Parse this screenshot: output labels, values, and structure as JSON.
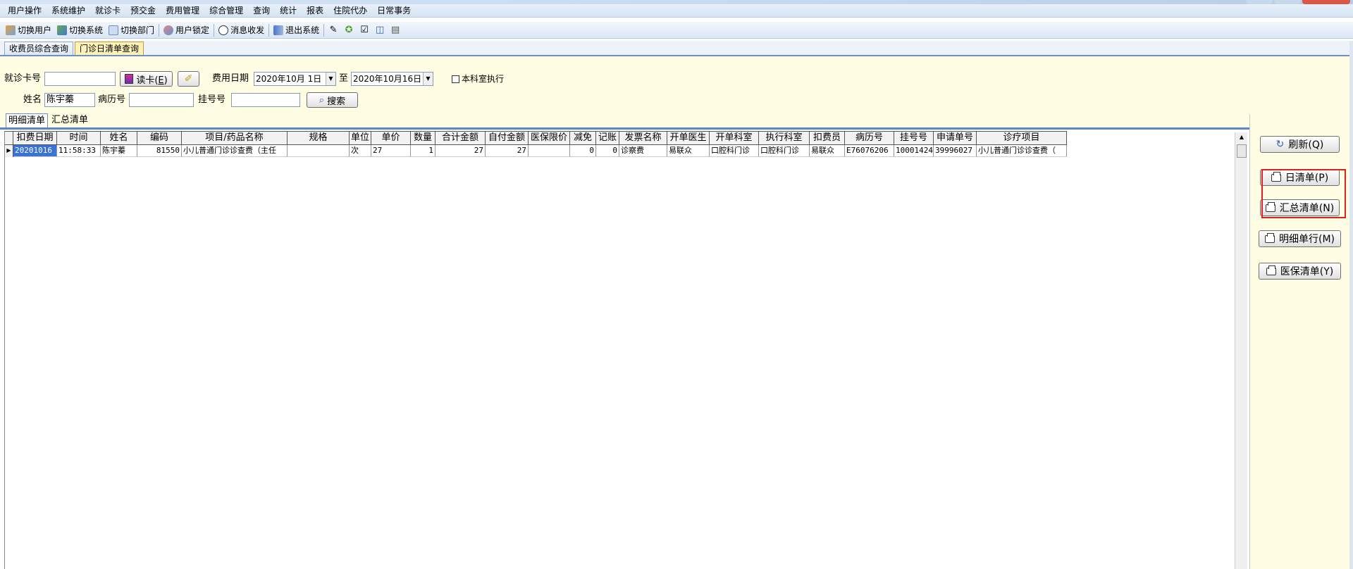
{
  "menu": [
    "用户操作",
    "系统维护",
    "就诊卡",
    "预交金",
    "费用管理",
    "综合管理",
    "查询",
    "统计",
    "报表",
    "住院代办",
    "日常事务"
  ],
  "toolbar": {
    "switch_user": "切换用户",
    "switch_system": "切换系统",
    "switch_dept": "切换部门",
    "lock_user": "用户锁定",
    "messages": "消息收发",
    "exit_system": "退出系统"
  },
  "page_tabs": [
    "收费员综合查询",
    "门诊日清单查询"
  ],
  "query": {
    "card_label": "就诊卡号",
    "card_value": "",
    "read_card_button": "读卡(<u>E</u>)",
    "fee_date_label": "费用日期",
    "date_from": "2020年10月 1日",
    "to_label": "至",
    "date_to": "2020年10月16日",
    "dept_exec_label": "本科室执行",
    "name_label": "姓名",
    "name_value": "陈宇蓁",
    "record_no_label": "病历号",
    "record_no_value": "",
    "reg_no_label": "挂号号",
    "reg_no_value": "",
    "search_button": "搜索"
  },
  "inner_tabs": [
    "明细清单",
    "汇总清单"
  ],
  "grid": {
    "columns": [
      "扣费日期",
      "时间",
      "姓名",
      "编码",
      "项目/药品名称",
      "规格",
      "单位",
      "单价",
      "数量",
      "合计金额",
      "自付金额",
      "医保限价",
      "减免",
      "记账",
      "发票名称",
      "开单医生",
      "开单科室",
      "执行科室",
      "扣费员",
      "病历号",
      "挂号号",
      "申请单号",
      "诊疗项目"
    ],
    "rows": [
      [
        "20201016",
        "11:58:33",
        "陈宇蓁",
        "81550",
        "小儿普通门诊诊查费（主任",
        "",
        "次",
        "27",
        "1",
        "27",
        "27",
        "",
        "0",
        "0",
        "诊察费",
        "易联众",
        "口腔科门诊",
        "口腔科门诊",
        "易联众",
        "E76076206",
        "10001424",
        "39996027",
        "小儿普通门诊诊查费（"
      ]
    ]
  },
  "right_buttons": {
    "refresh": "刷新(Q)",
    "daily_list": "日清单(P)",
    "summary_list": "汇总清单(N)",
    "detail_row": "明细单行(M)",
    "insurance_list": "医保清单(Y)"
  },
  "colors": {
    "panel_bg": "#fffee4",
    "selection": "#3a73d6",
    "highlight_box": "#e02020"
  }
}
